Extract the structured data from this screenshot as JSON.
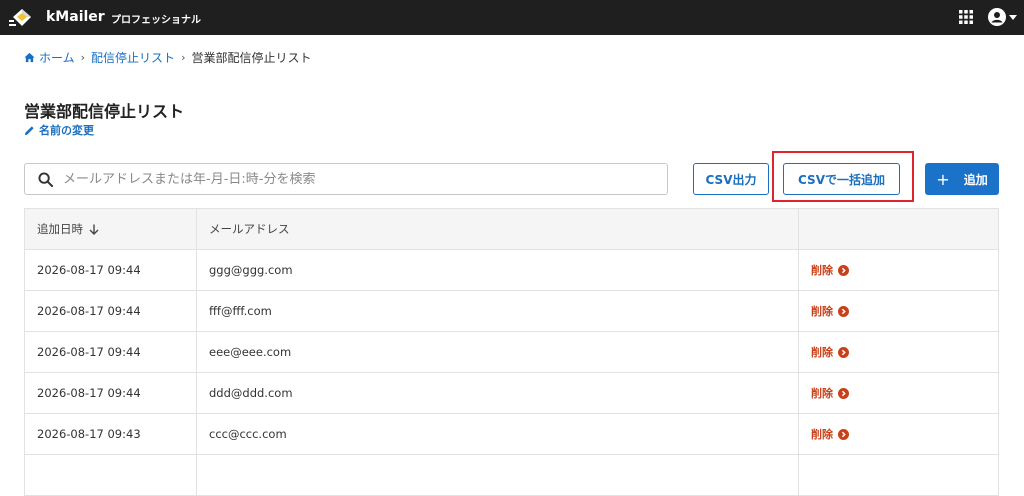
{
  "app": {
    "brand": "kMailer",
    "plan": "プロフェッショナル"
  },
  "breadcrumb": {
    "home": "ホーム",
    "parent": "配信停止リスト",
    "current": "営業部配信停止リスト"
  },
  "page": {
    "title": "営業部配信停止リスト",
    "rename_label": "名前の変更"
  },
  "toolbar": {
    "search_placeholder": "メールアドレスまたは年-月-日:時-分を検索",
    "search_value": "",
    "csv_export_label": "CSV出力",
    "csv_bulk_add_label": "CSVで一括追加",
    "add_label": "追加"
  },
  "table": {
    "columns": [
      "追加日時",
      "メールアドレス",
      ""
    ],
    "rows": [
      {
        "added_at": "2026-08-17 09:44",
        "email": "ggg@ggg.com",
        "action": "削除"
      },
      {
        "added_at": "2026-08-17 09:44",
        "email": "fff@fff.com",
        "action": "削除"
      },
      {
        "added_at": "2026-08-17 09:44",
        "email": "eee@eee.com",
        "action": "削除"
      },
      {
        "added_at": "2026-08-17 09:44",
        "email": "ddd@ddd.com",
        "action": "削除"
      },
      {
        "added_at": "2026-08-17 09:43",
        "email": "ccc@ccc.com",
        "action": "削除"
      },
      {
        "added_at": "",
        "email": "",
        "action": ""
      }
    ]
  },
  "colors": {
    "topbar": "#1f1f1f",
    "accent": "#1a6fbf",
    "primary_button": "#1a73c8",
    "delete": "#c7421b",
    "highlight": "#e0232d"
  },
  "icons": {
    "logo": "kmailer-logo-icon",
    "apps": "apps-grid-icon",
    "user": "user-circle-icon",
    "home": "home-icon",
    "edit": "pencil-icon",
    "search": "search-icon",
    "sort": "arrow-down-icon",
    "delete": "chevron-right-circle-icon"
  }
}
